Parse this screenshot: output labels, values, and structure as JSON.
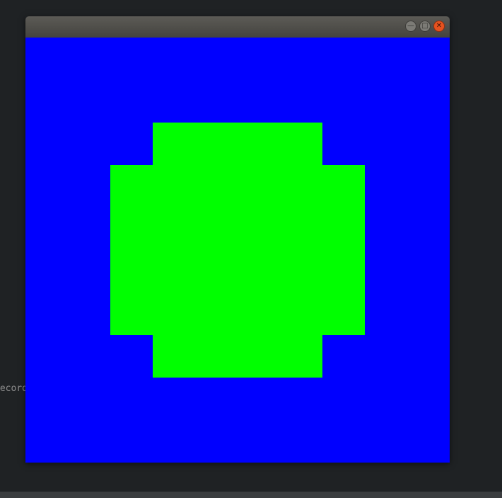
{
  "desktop": {
    "partial_text": "Record"
  },
  "window": {
    "controls": {
      "minimize_icon": "minimize-icon",
      "maximize_icon": "maximize-icon",
      "close_icon": "close-icon"
    }
  },
  "canvas": {
    "background_color": "#0000ff",
    "shape_color": "#00ff00"
  },
  "colors": {
    "desktop_bg": "#1f2224",
    "titlebar": "#4e4d49",
    "close_button": "#e6521f"
  }
}
